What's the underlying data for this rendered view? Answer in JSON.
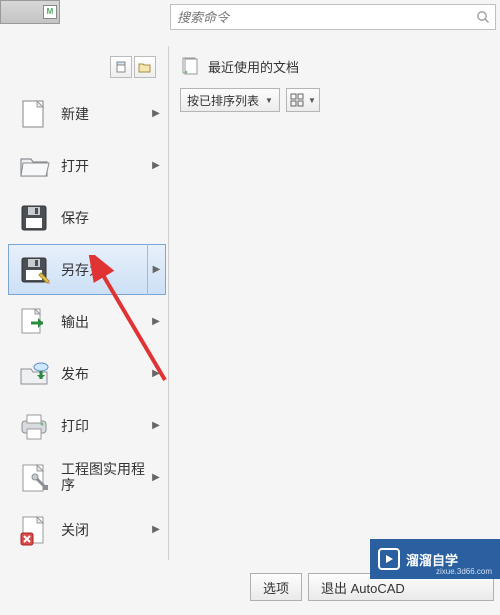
{
  "search": {
    "placeholder": "搜索命令"
  },
  "recent": {
    "label": "最近使用的文档"
  },
  "sort": {
    "label": "按已排序列表"
  },
  "menu": {
    "new": {
      "label": "新建"
    },
    "open": {
      "label": "打开"
    },
    "save": {
      "label": "保存"
    },
    "saveas": {
      "label": "另存为"
    },
    "export": {
      "label": "输出"
    },
    "publish": {
      "label": "发布"
    },
    "print": {
      "label": "打印"
    },
    "drwutil": {
      "label": "工程图实用程序"
    },
    "close": {
      "label": "关闭"
    }
  },
  "bottom": {
    "options": "选项",
    "exit": "退出 AutoCAD"
  },
  "badge": {
    "title": "溜溜自学",
    "sub": "zixue.3d66.com"
  }
}
